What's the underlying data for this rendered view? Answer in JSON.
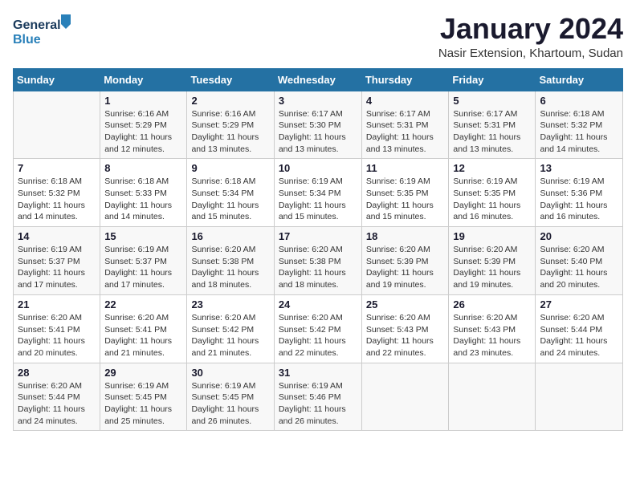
{
  "logo": {
    "line1": "General",
    "line2": "Blue"
  },
  "title": "January 2024",
  "subtitle": "Nasir Extension, Khartoum, Sudan",
  "weekdays": [
    "Sunday",
    "Monday",
    "Tuesday",
    "Wednesday",
    "Thursday",
    "Friday",
    "Saturday"
  ],
  "weeks": [
    [
      {
        "day": "",
        "sunrise": "",
        "sunset": "",
        "daylight": ""
      },
      {
        "day": "1",
        "sunrise": "Sunrise: 6:16 AM",
        "sunset": "Sunset: 5:29 PM",
        "daylight": "Daylight: 11 hours and 12 minutes."
      },
      {
        "day": "2",
        "sunrise": "Sunrise: 6:16 AM",
        "sunset": "Sunset: 5:29 PM",
        "daylight": "Daylight: 11 hours and 13 minutes."
      },
      {
        "day": "3",
        "sunrise": "Sunrise: 6:17 AM",
        "sunset": "Sunset: 5:30 PM",
        "daylight": "Daylight: 11 hours and 13 minutes."
      },
      {
        "day": "4",
        "sunrise": "Sunrise: 6:17 AM",
        "sunset": "Sunset: 5:31 PM",
        "daylight": "Daylight: 11 hours and 13 minutes."
      },
      {
        "day": "5",
        "sunrise": "Sunrise: 6:17 AM",
        "sunset": "Sunset: 5:31 PM",
        "daylight": "Daylight: 11 hours and 13 minutes."
      },
      {
        "day": "6",
        "sunrise": "Sunrise: 6:18 AM",
        "sunset": "Sunset: 5:32 PM",
        "daylight": "Daylight: 11 hours and 14 minutes."
      }
    ],
    [
      {
        "day": "7",
        "sunrise": "Sunrise: 6:18 AM",
        "sunset": "Sunset: 5:32 PM",
        "daylight": "Daylight: 11 hours and 14 minutes."
      },
      {
        "day": "8",
        "sunrise": "Sunrise: 6:18 AM",
        "sunset": "Sunset: 5:33 PM",
        "daylight": "Daylight: 11 hours and 14 minutes."
      },
      {
        "day": "9",
        "sunrise": "Sunrise: 6:18 AM",
        "sunset": "Sunset: 5:34 PM",
        "daylight": "Daylight: 11 hours and 15 minutes."
      },
      {
        "day": "10",
        "sunrise": "Sunrise: 6:19 AM",
        "sunset": "Sunset: 5:34 PM",
        "daylight": "Daylight: 11 hours and 15 minutes."
      },
      {
        "day": "11",
        "sunrise": "Sunrise: 6:19 AM",
        "sunset": "Sunset: 5:35 PM",
        "daylight": "Daylight: 11 hours and 15 minutes."
      },
      {
        "day": "12",
        "sunrise": "Sunrise: 6:19 AM",
        "sunset": "Sunset: 5:35 PM",
        "daylight": "Daylight: 11 hours and 16 minutes."
      },
      {
        "day": "13",
        "sunrise": "Sunrise: 6:19 AM",
        "sunset": "Sunset: 5:36 PM",
        "daylight": "Daylight: 11 hours and 16 minutes."
      }
    ],
    [
      {
        "day": "14",
        "sunrise": "Sunrise: 6:19 AM",
        "sunset": "Sunset: 5:37 PM",
        "daylight": "Daylight: 11 hours and 17 minutes."
      },
      {
        "day": "15",
        "sunrise": "Sunrise: 6:19 AM",
        "sunset": "Sunset: 5:37 PM",
        "daylight": "Daylight: 11 hours and 17 minutes."
      },
      {
        "day": "16",
        "sunrise": "Sunrise: 6:20 AM",
        "sunset": "Sunset: 5:38 PM",
        "daylight": "Daylight: 11 hours and 18 minutes."
      },
      {
        "day": "17",
        "sunrise": "Sunrise: 6:20 AM",
        "sunset": "Sunset: 5:38 PM",
        "daylight": "Daylight: 11 hours and 18 minutes."
      },
      {
        "day": "18",
        "sunrise": "Sunrise: 6:20 AM",
        "sunset": "Sunset: 5:39 PM",
        "daylight": "Daylight: 11 hours and 19 minutes."
      },
      {
        "day": "19",
        "sunrise": "Sunrise: 6:20 AM",
        "sunset": "Sunset: 5:39 PM",
        "daylight": "Daylight: 11 hours and 19 minutes."
      },
      {
        "day": "20",
        "sunrise": "Sunrise: 6:20 AM",
        "sunset": "Sunset: 5:40 PM",
        "daylight": "Daylight: 11 hours and 20 minutes."
      }
    ],
    [
      {
        "day": "21",
        "sunrise": "Sunrise: 6:20 AM",
        "sunset": "Sunset: 5:41 PM",
        "daylight": "Daylight: 11 hours and 20 minutes."
      },
      {
        "day": "22",
        "sunrise": "Sunrise: 6:20 AM",
        "sunset": "Sunset: 5:41 PM",
        "daylight": "Daylight: 11 hours and 21 minutes."
      },
      {
        "day": "23",
        "sunrise": "Sunrise: 6:20 AM",
        "sunset": "Sunset: 5:42 PM",
        "daylight": "Daylight: 11 hours and 21 minutes."
      },
      {
        "day": "24",
        "sunrise": "Sunrise: 6:20 AM",
        "sunset": "Sunset: 5:42 PM",
        "daylight": "Daylight: 11 hours and 22 minutes."
      },
      {
        "day": "25",
        "sunrise": "Sunrise: 6:20 AM",
        "sunset": "Sunset: 5:43 PM",
        "daylight": "Daylight: 11 hours and 22 minutes."
      },
      {
        "day": "26",
        "sunrise": "Sunrise: 6:20 AM",
        "sunset": "Sunset: 5:43 PM",
        "daylight": "Daylight: 11 hours and 23 minutes."
      },
      {
        "day": "27",
        "sunrise": "Sunrise: 6:20 AM",
        "sunset": "Sunset: 5:44 PM",
        "daylight": "Daylight: 11 hours and 24 minutes."
      }
    ],
    [
      {
        "day": "28",
        "sunrise": "Sunrise: 6:20 AM",
        "sunset": "Sunset: 5:44 PM",
        "daylight": "Daylight: 11 hours and 24 minutes."
      },
      {
        "day": "29",
        "sunrise": "Sunrise: 6:19 AM",
        "sunset": "Sunset: 5:45 PM",
        "daylight": "Daylight: 11 hours and 25 minutes."
      },
      {
        "day": "30",
        "sunrise": "Sunrise: 6:19 AM",
        "sunset": "Sunset: 5:45 PM",
        "daylight": "Daylight: 11 hours and 26 minutes."
      },
      {
        "day": "31",
        "sunrise": "Sunrise: 6:19 AM",
        "sunset": "Sunset: 5:46 PM",
        "daylight": "Daylight: 11 hours and 26 minutes."
      },
      {
        "day": "",
        "sunrise": "",
        "sunset": "",
        "daylight": ""
      },
      {
        "day": "",
        "sunrise": "",
        "sunset": "",
        "daylight": ""
      },
      {
        "day": "",
        "sunrise": "",
        "sunset": "",
        "daylight": ""
      }
    ]
  ]
}
